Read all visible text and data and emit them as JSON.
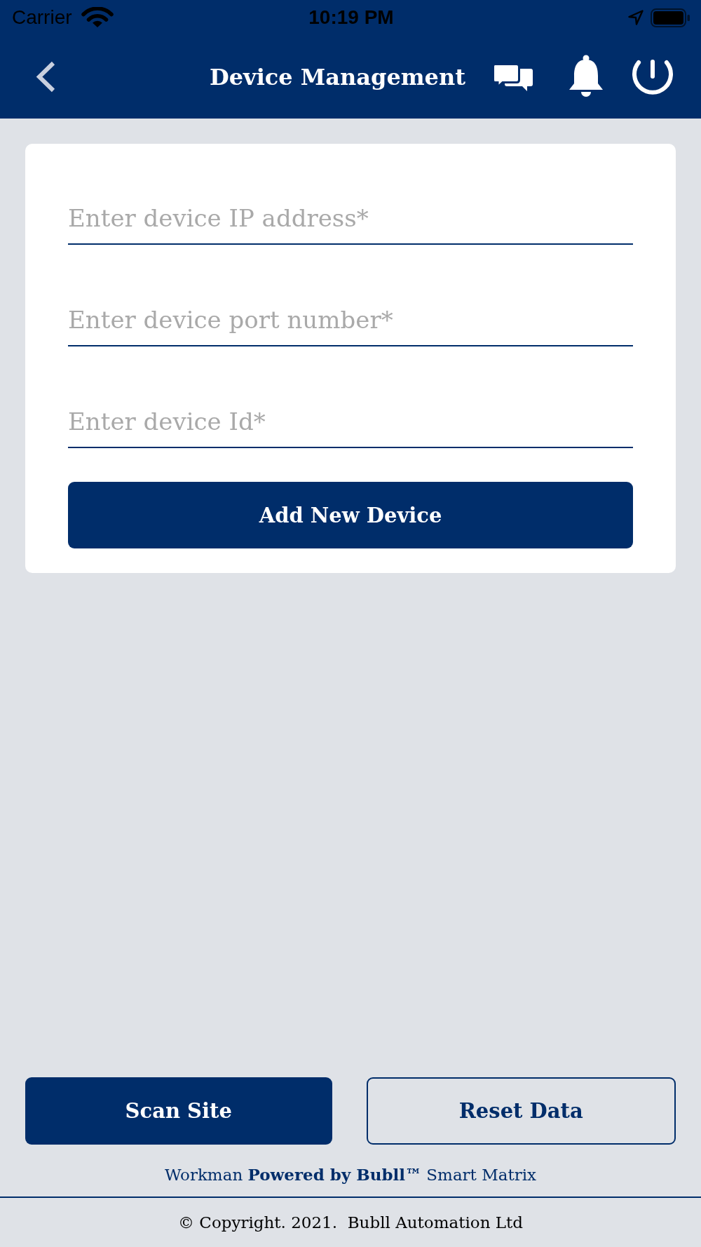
{
  "status_bar": {
    "carrier": "Carrier",
    "time": "10:19 PM"
  },
  "header": {
    "title": "Device Management"
  },
  "form": {
    "fields": [
      {
        "placeholder": "Enter device IP address*"
      },
      {
        "placeholder": "Enter device port number*"
      },
      {
        "placeholder": "Enter device Id*"
      }
    ],
    "submit": "Add New Device"
  },
  "actions": [
    {
      "label": "Scan Site",
      "kind": "primary"
    },
    {
      "label": "Reset Data",
      "kind": "outline"
    }
  ],
  "footer": {
    "tagline": "Workman **Powered by Bubll™** Smart Matrix",
    "copyright": "© Copyright. 2021.  Bubll Automation Ltd"
  }
}
